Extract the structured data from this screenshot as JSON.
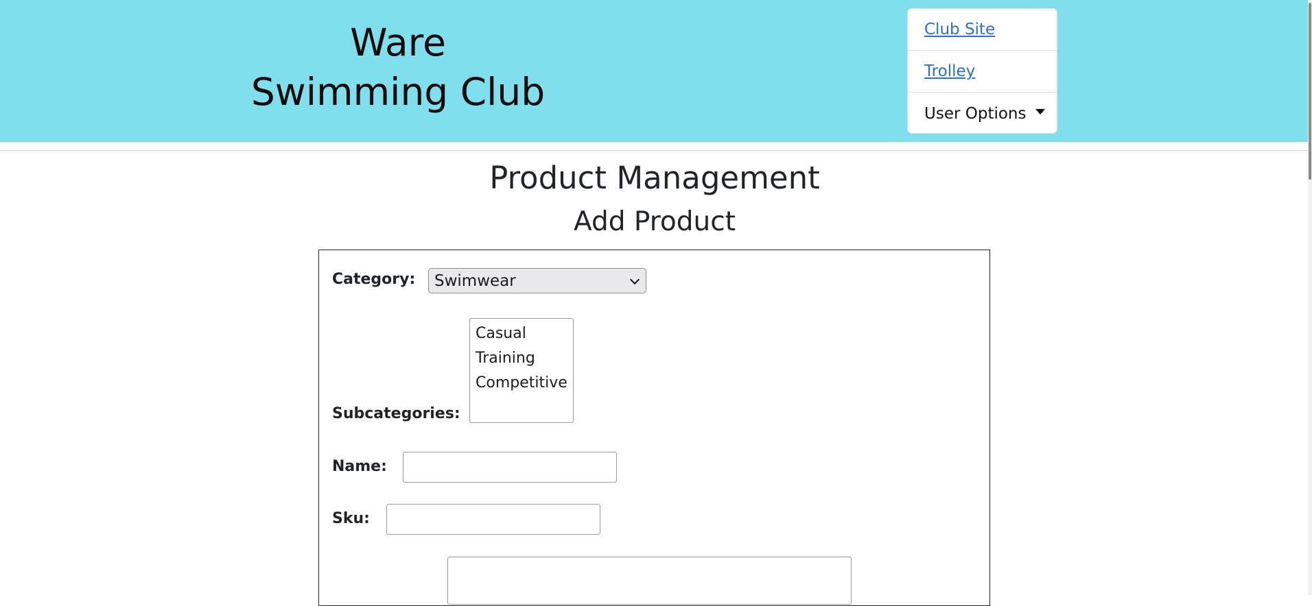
{
  "header": {
    "brand_line1": "Ware",
    "brand_line2": "Swimming Club",
    "nav": {
      "club_site": "Club Site",
      "trolley": "Trolley",
      "user_options": "User Options"
    },
    "background_color": "#7fdfed"
  },
  "main": {
    "title": "Product Management",
    "subtitle": "Add Product"
  },
  "form": {
    "category_label": "Category:",
    "category_value": "Swimwear",
    "subcategories_label": "Subcategories:",
    "subcategory_options": [
      "Casual",
      "Training",
      "Competitive"
    ],
    "name_label": "Name:",
    "name_value": "",
    "sku_label": "Sku:",
    "sku_value": "",
    "description_value": ""
  }
}
